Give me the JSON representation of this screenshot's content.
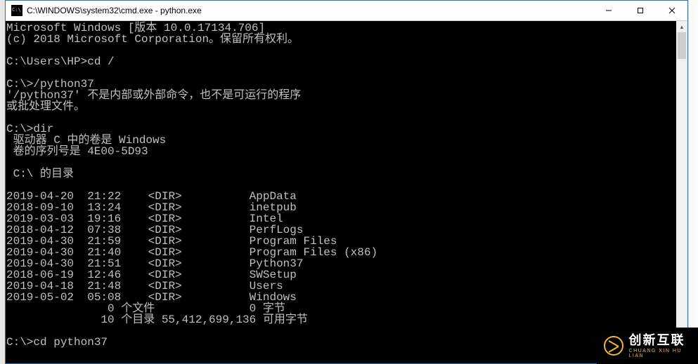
{
  "window": {
    "title": "C:\\WINDOWS\\system32\\cmd.exe - python.exe"
  },
  "terminal": {
    "lines": [
      "Microsoft Windows [版本 10.0.17134.706]",
      "(c) 2018 Microsoft Corporation。保留所有权利。",
      "",
      "C:\\Users\\HP>cd /",
      "",
      "C:\\>/python37",
      "'/python37' 不是内部或外部命令，也不是可运行的程序",
      "或批处理文件。",
      "",
      "C:\\>dir",
      " 驱动器 C 中的卷是 Windows",
      " 卷的序列号是 4E00-5D93",
      "",
      " C:\\ 的目录",
      "",
      "2019-04-20  21:22    <DIR>          AppData",
      "2018-09-10  13:24    <DIR>          inetpub",
      "2019-03-03  19:16    <DIR>          Intel",
      "2018-04-12  07:38    <DIR>          PerfLogs",
      "2019-04-30  21:59    <DIR>          Program Files",
      "2019-04-30  21:40    <DIR>          Program Files (x86)",
      "2019-04-30  21:51    <DIR>          Python37",
      "2018-06-19  12:46    <DIR>          SWSetup",
      "2019-04-18  21:48    <DIR>          Users",
      "2019-05-02  05:08    <DIR>          Windows",
      "               0 个文件              0 字节",
      "              10 个目录 55,412,699,136 可用字节",
      "",
      "C:\\>cd python37"
    ]
  },
  "dir_listing": [
    {
      "date": "2019-04-20",
      "time": "21:22",
      "type": "<DIR>",
      "name": "AppData"
    },
    {
      "date": "2018-09-10",
      "time": "13:24",
      "type": "<DIR>",
      "name": "inetpub"
    },
    {
      "date": "2019-03-03",
      "time": "19:16",
      "type": "<DIR>",
      "name": "Intel"
    },
    {
      "date": "2018-04-12",
      "time": "07:38",
      "type": "<DIR>",
      "name": "PerfLogs"
    },
    {
      "date": "2019-04-30",
      "time": "21:59",
      "type": "<DIR>",
      "name": "Program Files"
    },
    {
      "date": "2019-04-30",
      "time": "21:40",
      "type": "<DIR>",
      "name": "Program Files (x86)"
    },
    {
      "date": "2019-04-30",
      "time": "21:51",
      "type": "<DIR>",
      "name": "Python37"
    },
    {
      "date": "2018-06-19",
      "time": "12:46",
      "type": "<DIR>",
      "name": "SWSetup"
    },
    {
      "date": "2019-04-18",
      "time": "21:48",
      "type": "<DIR>",
      "name": "Users"
    },
    {
      "date": "2019-05-02",
      "time": "05:08",
      "type": "<DIR>",
      "name": "Windows"
    }
  ],
  "dir_summary": {
    "files": 0,
    "file_bytes": 0,
    "dirs": 10,
    "free_bytes": "55,412,699,136"
  },
  "watermark": {
    "cn": "创新互联",
    "en": "CHUANG XIN HU LIAN"
  }
}
